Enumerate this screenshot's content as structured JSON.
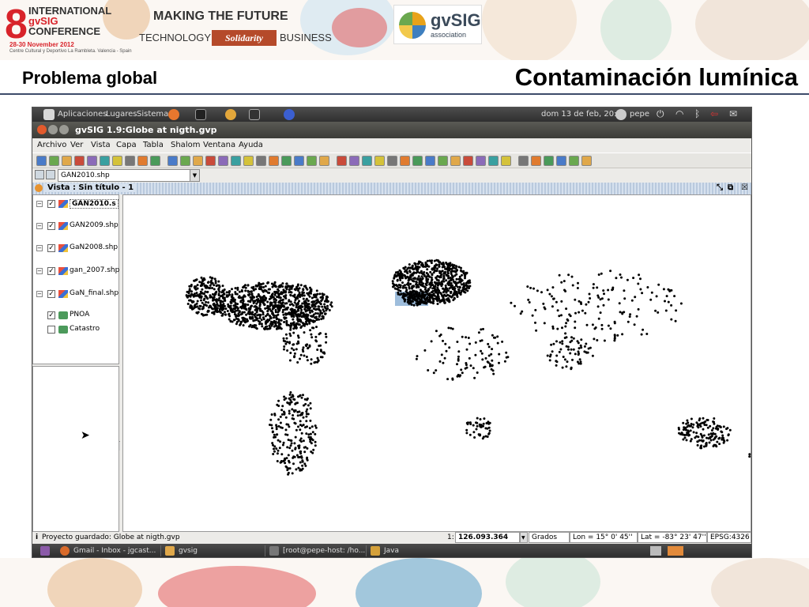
{
  "banner": {
    "conference_number": "8",
    "conference_line1": "INTERNATIONAL",
    "conference_line2": "gvSIG",
    "conference_line3": "CONFERENCE",
    "conference_dates": "28-30 November 2012",
    "conference_venue": "Centre Cultural y Deportivo La Rambleta. Valencia - Spain",
    "motto_making": "MAKING THE FUTURE",
    "motto_technology": "TECHNOLOGY",
    "motto_solidarity": "Solidarity",
    "motto_business": "BUSINESS",
    "association_name": "gvSIG",
    "association_sub": "association"
  },
  "slide": {
    "left_title": "Problema global",
    "right_title": "Contaminación lumínica"
  },
  "desktop": {
    "menus": [
      "Aplicaciones",
      "Lugares",
      "Sistema"
    ],
    "clock": "dom 13 de feb, 20:23",
    "user": "pepe"
  },
  "window": {
    "title": "gvSIG 1.9:Globe at nigth.gvp",
    "menu": [
      "Archivo",
      "Ver",
      "Vista",
      "Capa",
      "Tabla",
      "Shalom",
      "Ventana",
      "Ayuda"
    ],
    "active_layer": "GAN2010.shp"
  },
  "view": {
    "title": "Vista : Sin título - 1",
    "layers": [
      {
        "name": "GAN2010.s",
        "checked": true,
        "selected": true
      },
      {
        "name": "GAN2009.shp",
        "checked": true,
        "selected": false
      },
      {
        "name": "GaN2008.shp",
        "checked": true,
        "selected": false
      },
      {
        "name": "gan_2007.shp",
        "checked": true,
        "selected": false
      },
      {
        "name": "GaN_final.shp",
        "checked": true,
        "selected": false
      },
      {
        "name": "PNOA",
        "checked": true,
        "selected": false
      },
      {
        "name": "Catastro",
        "checked": false,
        "selected": false
      }
    ]
  },
  "status": {
    "message": "Proyecto guardado: Globe at nigth.gvp",
    "scale_prefix": "1:",
    "scale": "126.093.364",
    "units": "Grados",
    "lon": "Lon = 15° 0' 45''",
    "lat": "Lat = -83° 23' 47''",
    "epsg": "EPSG:4326"
  },
  "taskbar": [
    {
      "label": "Gmail - Inbox - jgcast...",
      "color": "#d96b2b"
    },
    {
      "label": "gvsig",
      "color": "#e0a84a"
    },
    {
      "label": "[root@pepe-host: /ho...",
      "color": "#777777"
    },
    {
      "label": "Java",
      "color": "#d4a03a"
    }
  ]
}
